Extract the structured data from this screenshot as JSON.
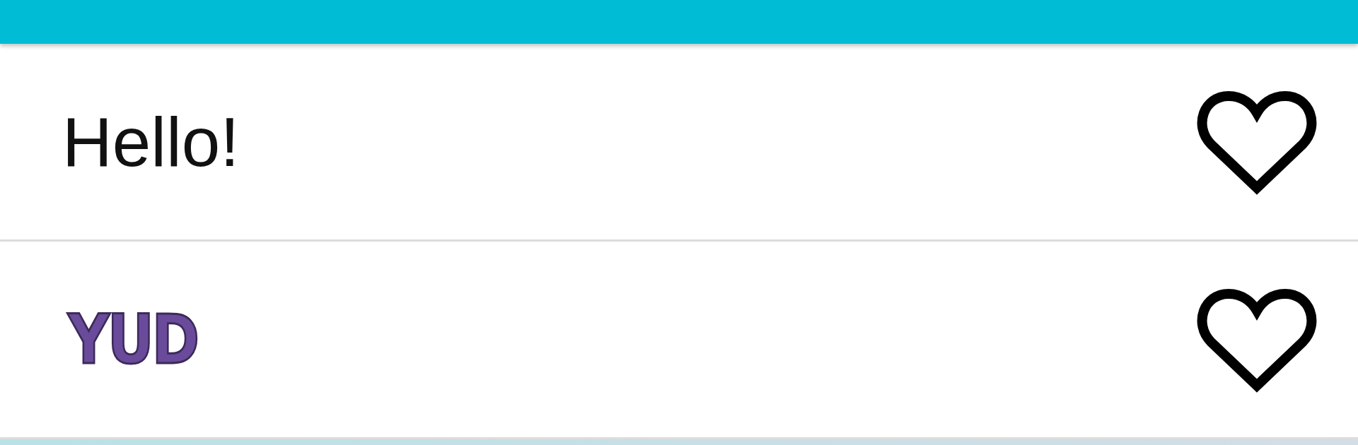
{
  "items": [
    {
      "text": "Hello!",
      "kind": "plain",
      "favorite": false
    },
    {
      "text": "YUD",
      "kind": "styled",
      "favorite": false
    }
  ]
}
